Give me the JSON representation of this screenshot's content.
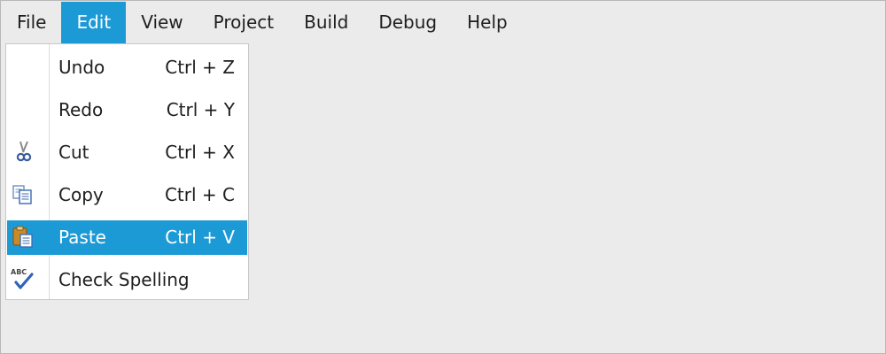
{
  "menubar": {
    "items": [
      {
        "label": "File"
      },
      {
        "label": "Edit",
        "active": true
      },
      {
        "label": "View"
      },
      {
        "label": "Project"
      },
      {
        "label": "Build"
      },
      {
        "label": "Debug"
      },
      {
        "label": "Help"
      }
    ]
  },
  "edit_menu": {
    "items": [
      {
        "label": "Undo",
        "shortcut": "Ctrl + Z",
        "icon": null
      },
      {
        "label": "Redo",
        "shortcut": "Ctrl + Y",
        "icon": null
      },
      {
        "label": "Cut",
        "shortcut": "Ctrl + X",
        "icon": "scissors-icon"
      },
      {
        "label": "Copy",
        "shortcut": "Ctrl + C",
        "icon": "copy-icon"
      },
      {
        "label": "Paste",
        "shortcut": "Ctrl + V",
        "icon": "paste-icon",
        "highlighted": true
      },
      {
        "label": "Check Spelling",
        "shortcut": "",
        "icon": "spellcheck-icon",
        "icon_text": "ABC"
      }
    ]
  },
  "colors": {
    "accent": "#1c9ad6",
    "window_background": "#ebebeb",
    "menu_background": "#ffffff",
    "text": "#1e1e1e",
    "highlight_text": "#ffffff"
  }
}
